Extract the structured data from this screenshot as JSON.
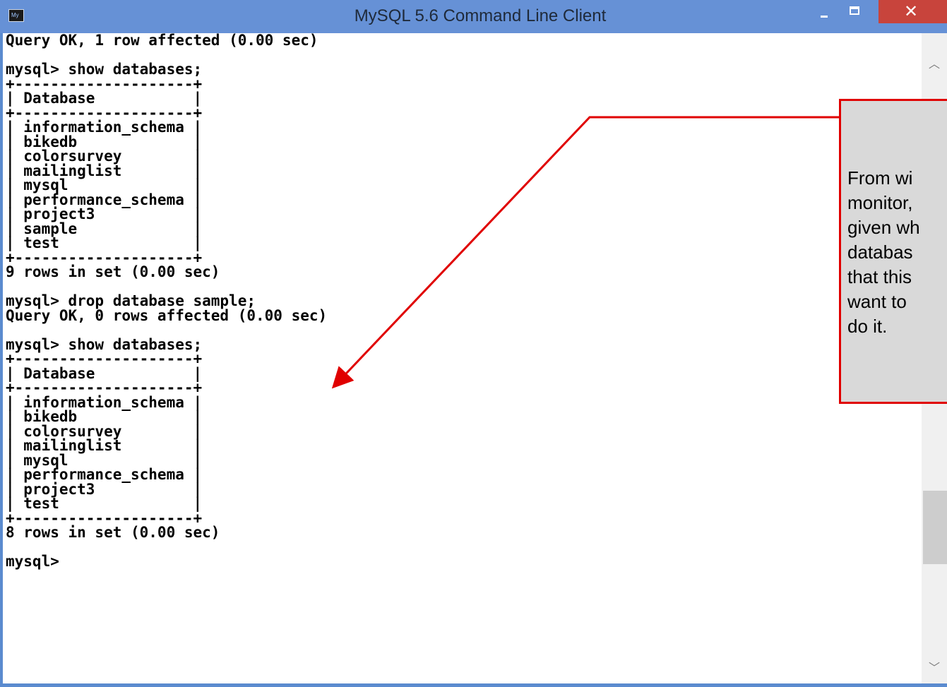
{
  "window": {
    "title": "MySQL 5.6 Command Line Client",
    "icon_label": "My",
    "controls": {
      "minimize": "minimize-icon",
      "maximize": "maximize-icon",
      "close": "close-icon"
    }
  },
  "console": {
    "lines": [
      "Query OK, 1 row affected (0.00 sec)",
      "",
      "mysql> show databases;",
      "+--------------------+",
      "| Database           |",
      "+--------------------+",
      "| information_schema |",
      "| bikedb             |",
      "| colorsurvey        |",
      "| mailinglist        |",
      "| mysql              |",
      "| performance_schema |",
      "| project3           |",
      "| sample             |",
      "| test               |",
      "+--------------------+",
      "9 rows in set (0.00 sec)",
      "",
      "mysql> drop database sample;",
      "Query OK, 0 rows affected (0.00 sec)",
      "",
      "mysql> show databases;",
      "+--------------------+",
      "| Database           |",
      "+--------------------+",
      "| information_schema |",
      "| bikedb             |",
      "| colorsurvey        |",
      "| mailinglist        |",
      "| mysql              |",
      "| performance_schema |",
      "| project3           |",
      "| test               |",
      "+--------------------+",
      "8 rows in set (0.00 sec)",
      "",
      "mysql>"
    ]
  },
  "callout": {
    "lines": [
      "From wi",
      "monitor,",
      "given wh",
      "databas",
      "that this",
      "want to",
      "do it."
    ]
  },
  "colors": {
    "titlebar": "#6691d6",
    "close_button": "#c8443c",
    "callout_border": "#e00000",
    "callout_fill": "#d9d9d9",
    "arrow": "#e00000"
  }
}
